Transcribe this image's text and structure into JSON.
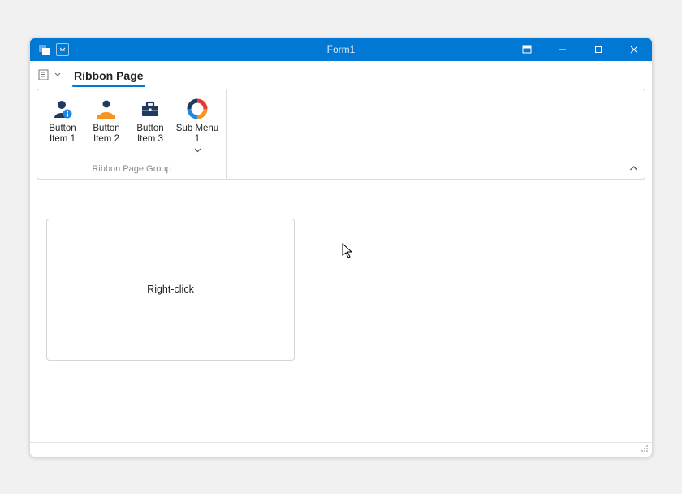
{
  "window": {
    "title": "Form1"
  },
  "ribbon": {
    "tabs": [
      {
        "label": "Ribbon Page",
        "active": true
      }
    ],
    "group_caption": "Ribbon Page Group",
    "items": [
      {
        "label": "Button\nItem 1"
      },
      {
        "label": "Button\nItem 2"
      },
      {
        "label": "Button\nItem 3"
      },
      {
        "label": "Sub Menu 1",
        "has_dropdown": true
      }
    ]
  },
  "panel": {
    "text": "Right-click"
  }
}
